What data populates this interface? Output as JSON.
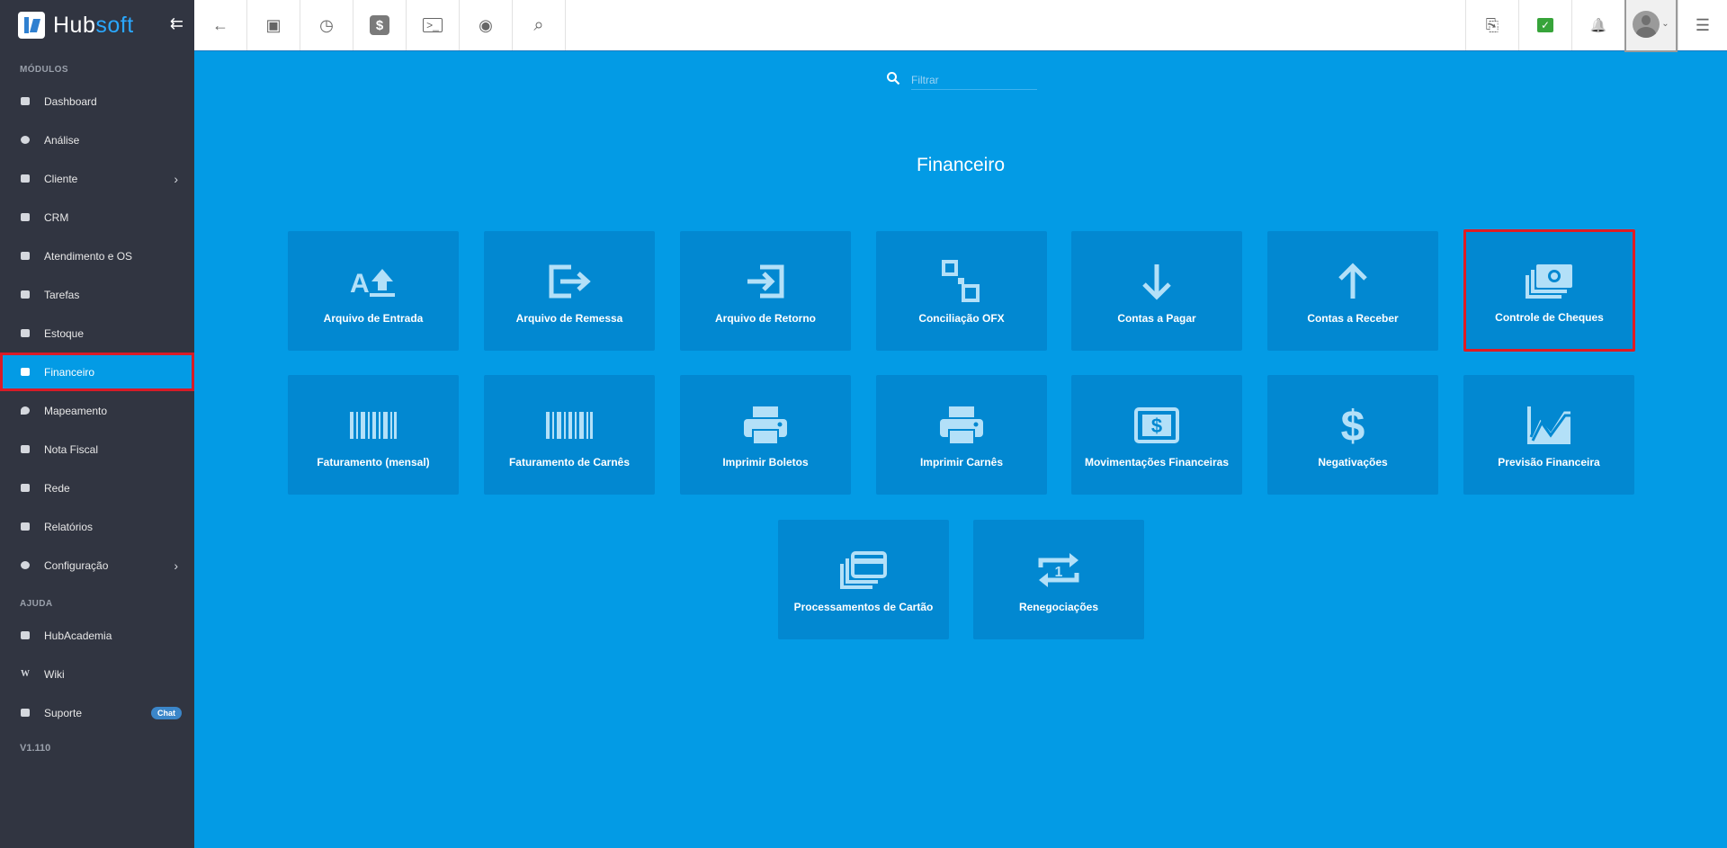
{
  "brand": {
    "name_left": "Hub",
    "name_right": "soft",
    "collapse": "⇇"
  },
  "sidebar": {
    "modules_title": "MÓDULOS",
    "items": [
      {
        "label": "Dashboard"
      },
      {
        "label": "Análise"
      },
      {
        "label": "Cliente",
        "chevron": "›"
      },
      {
        "label": "CRM"
      },
      {
        "label": "Atendimento e OS"
      },
      {
        "label": "Tarefas"
      },
      {
        "label": "Estoque"
      },
      {
        "label": "Financeiro",
        "active": true
      },
      {
        "label": "Mapeamento"
      },
      {
        "label": "Nota Fiscal"
      },
      {
        "label": "Rede"
      },
      {
        "label": "Relatórios"
      },
      {
        "label": "Configuração",
        "chevron": "›"
      }
    ],
    "help_title": "AJUDA",
    "help_items": [
      {
        "label": "HubAcademia"
      },
      {
        "label": "Wiki"
      },
      {
        "label": "Suporte",
        "badge": "Chat"
      }
    ],
    "version": "V1.110"
  },
  "toolbar": {
    "back": "←",
    "contact": "▣",
    "schedule": "◷",
    "money": "$",
    "terminal": ">_",
    "view": "◉",
    "search": "⌕",
    "pdf": "⎘",
    "check": "✓",
    "bell": "🔔",
    "avatar_chevron": "⌄",
    "list": "☰"
  },
  "filter": {
    "placeholder": "Filtrar",
    "icon": "search-icon"
  },
  "page_title": "Financeiro",
  "tiles": [
    {
      "label": "Arquivo de Entrada",
      "icon": "file-upload-icon"
    },
    {
      "label": "Arquivo de Remessa",
      "icon": "export-icon"
    },
    {
      "label": "Arquivo de Retorno",
      "icon": "import-icon"
    },
    {
      "label": "Conciliação OFX",
      "icon": "reconcile-icon"
    },
    {
      "label": "Contas a Pagar",
      "icon": "arrow-down-icon"
    },
    {
      "label": "Contas a Receber",
      "icon": "arrow-up-icon"
    },
    {
      "label": "Controle de Cheques",
      "icon": "money-stack-icon",
      "highlight": true
    },
    {
      "label": "Faturamento (mensal)",
      "icon": "barcode-icon"
    },
    {
      "label": "Faturamento de Carnês",
      "icon": "barcode-icon"
    },
    {
      "label": "Imprimir Boletos",
      "icon": "printer-icon"
    },
    {
      "label": "Imprimir Carnês",
      "icon": "printer-icon"
    },
    {
      "label": "Movimentações Financeiras",
      "icon": "dollar-box-icon"
    },
    {
      "label": "Negativações",
      "icon": "dollar-icon"
    },
    {
      "label": "Previsão Financeira",
      "icon": "chart-icon"
    },
    {
      "label": "Processamentos de Cartão",
      "icon": "cards-icon"
    },
    {
      "label": "Renegociações",
      "icon": "repeat-one-icon"
    }
  ],
  "colors": {
    "accent": "#039be5",
    "tile": "#0288d1",
    "highlight": "#e11b22",
    "sidebar": "#313541"
  }
}
